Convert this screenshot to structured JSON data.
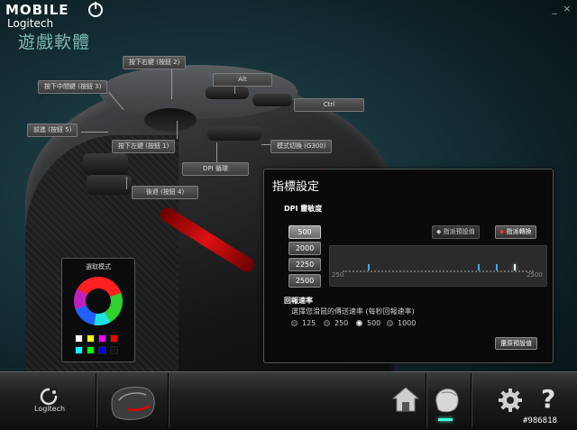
{
  "brand": {
    "mobile": "MOBILE",
    "logitech": "Logitech",
    "app_title": "遊戲軟體"
  },
  "window": {
    "minimize": "_",
    "close": "×"
  },
  "callouts": {
    "right_click": "按下右鍵 (按鈕 2)",
    "middle_click": "按下中間鍵 (按鈕 3)",
    "alt": "Alt",
    "ctrl": "Ctrl",
    "forward": "前進 (按鈕 5)",
    "left_click": "按下左鍵 (按鈕 1)",
    "mode_switch": "模式切換 (G300)",
    "dpi_cycle": "DPI 循環",
    "back": "後退 (按鈕 4)"
  },
  "pointer_panel": {
    "title": "指標設定",
    "dpi_title": "DPI 靈敏度",
    "dpi_levels": [
      "500",
      "2000",
      "2250",
      "2500"
    ],
    "set_default": "指派預設值",
    "set_shift": "指派轉換",
    "scale_min": "250",
    "scale_max": "2500",
    "report_title": "回報速率",
    "report_desc": "選擇您滑鼠的傳送速率 (每秒回報速率)",
    "report_rates": [
      "125",
      "250",
      "500",
      "1000"
    ],
    "report_selected": "500",
    "restore_default": "還原預設值"
  },
  "color_panel": {
    "title": "選取模式",
    "swatches": [
      "#ffffff",
      "#ffff00",
      "#ff00ff",
      "#ff0000",
      "#00ffff",
      "#00ff00",
      "#0000ff",
      "#111111"
    ]
  },
  "bottom": {
    "logitech_label": "Logitech",
    "help": "?"
  },
  "watermark": "#986818"
}
